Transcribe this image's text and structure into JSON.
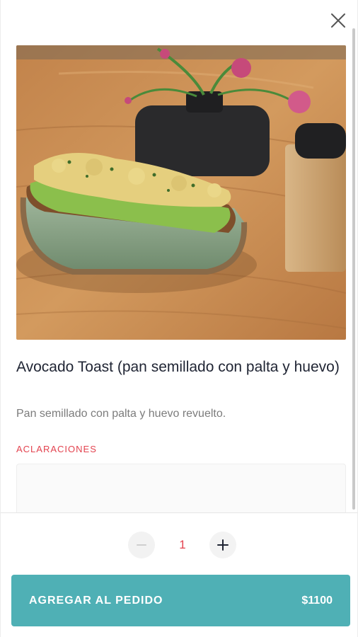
{
  "product": {
    "image_alt": "Avocado toast on a green plate on a wooden table",
    "title": "Avocado Toast (pan semillado con palta y huevo)",
    "description": "Pan semillado con palta y huevo revuelto."
  },
  "notes": {
    "label": "ACLARACIONES",
    "value": ""
  },
  "order": {
    "quantity": "1",
    "add_label": "AGREGAR AL PEDIDO",
    "price": "$1100"
  },
  "colors": {
    "accent": "#4fb0b5",
    "highlight": "#e3434f",
    "title_text": "#1f2433"
  }
}
